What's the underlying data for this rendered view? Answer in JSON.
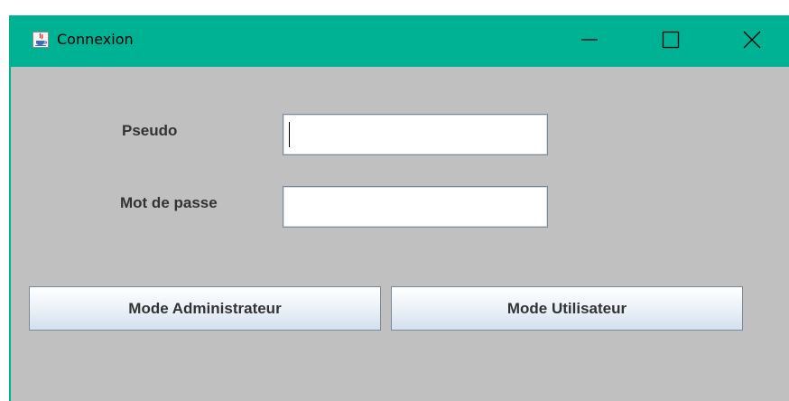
{
  "window": {
    "title": "Connexion",
    "icon": "java-coffee-icon",
    "controls": {
      "minimize": "minimize-icon",
      "maximize": "maximize-icon",
      "close": "close-icon"
    },
    "accent_color": "#00b294",
    "client_background": "#c0c0c0"
  },
  "form": {
    "pseudo_label": "Pseudo",
    "pseudo_value": "",
    "password_label": "Mot de passe",
    "password_value": ""
  },
  "buttons": {
    "admin_label": "Mode Administrateur",
    "user_label": "Mode Utilisateur"
  }
}
